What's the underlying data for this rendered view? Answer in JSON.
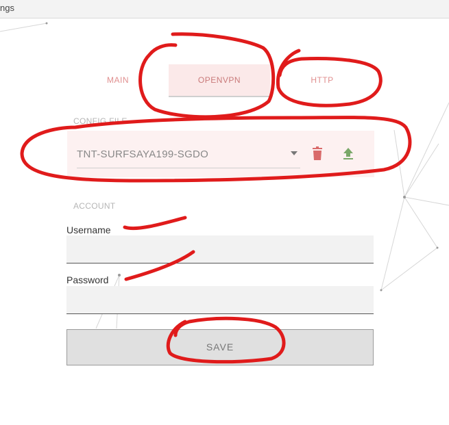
{
  "window": {
    "title_fragment": "ngs"
  },
  "tabs": {
    "main": "MAIN",
    "openvpn": "OPENVPN",
    "http": "HTTP",
    "active": "OPENVPN"
  },
  "config": {
    "section_label": "CONFIG FILE",
    "selected_file": "TNT-SURFSAYA199-SGDO",
    "delete_icon": "trash-icon",
    "upload_icon": "upload-icon"
  },
  "account": {
    "section_label": "ACCOUNT",
    "username_label": "Username",
    "username_value": "",
    "password_label": "Password",
    "password_value": ""
  },
  "save_label": "SAVE",
  "colors": {
    "accent_tab_bg": "#fbe9e9",
    "tab_text": "#e08f8f",
    "delete_icon": "#d96a6a",
    "upload_icon": "#7aa869",
    "annotation_red": "#e01b1b"
  }
}
